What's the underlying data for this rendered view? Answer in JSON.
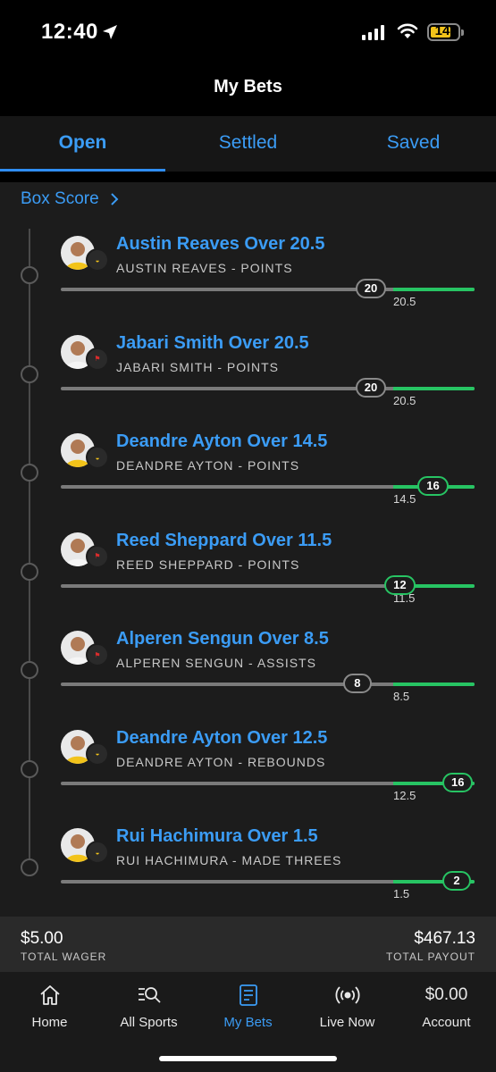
{
  "status_bar": {
    "time": "12:40",
    "battery": "14"
  },
  "header": {
    "title": "My Bets"
  },
  "tabs": [
    {
      "label": "Open",
      "active": true
    },
    {
      "label": "Settled",
      "active": false
    },
    {
      "label": "Saved",
      "active": false
    }
  ],
  "box_score": {
    "label": "Box Score"
  },
  "legs": [
    {
      "title": "Austin Reaves Over 20.5",
      "subtitle": "AUSTIN REAVES - POINTS",
      "team": "LAL",
      "current": "20",
      "line": "20.5",
      "progress": 0.79,
      "hit": false
    },
    {
      "title": "Jabari Smith Over 20.5",
      "subtitle": "JABARI SMITH - POINTS",
      "team": "HOU",
      "current": "20",
      "line": "20.5",
      "progress": 0.79,
      "hit": false
    },
    {
      "title": "Deandre Ayton Over 14.5",
      "subtitle": "DEANDRE AYTON - POINTS",
      "team": "LAL",
      "current": "16",
      "line": "14.5",
      "progress": 0.94,
      "hit": true
    },
    {
      "title": "Reed Sheppard Over 11.5",
      "subtitle": "REED SHEPPARD - POINTS",
      "team": "HOU",
      "current": "12",
      "line": "11.5",
      "progress": 0.86,
      "hit": true
    },
    {
      "title": "Alperen Sengun Over 8.5",
      "subtitle": "ALPEREN SENGUN - ASSISTS",
      "team": "HOU",
      "current": "8",
      "line": "8.5",
      "progress": 0.76,
      "hit": false
    },
    {
      "title": "Deandre Ayton Over 12.5",
      "subtitle": "DEANDRE AYTON - REBOUNDS",
      "team": "LAL",
      "current": "16",
      "line": "12.5",
      "progress": 1.0,
      "hit": true
    },
    {
      "title": "Rui Hachimura Over 1.5",
      "subtitle": "RUI HACHIMURA - MADE THREES",
      "team": "LAL",
      "current": "2",
      "line": "1.5",
      "progress": 1.0,
      "hit": true
    }
  ],
  "summary": {
    "wager": "$5.00",
    "wager_label": "TOTAL WAGER",
    "payout": "$467.13",
    "payout_label": "TOTAL PAYOUT"
  },
  "nav": [
    {
      "label": "Home",
      "icon": "house-icon",
      "active": false
    },
    {
      "label": "All Sports",
      "icon": "search-list-icon",
      "active": false
    },
    {
      "label": "My Bets",
      "icon": "betslip-icon",
      "active": true
    },
    {
      "label": "Live Now",
      "icon": "broadcast-icon",
      "active": false
    },
    {
      "label": "Account",
      "amount": "$0.00",
      "icon": "",
      "active": false
    }
  ],
  "colors": {
    "accent": "#3b9cf5",
    "hit": "#27c463",
    "miss": "#7a7a7a"
  }
}
